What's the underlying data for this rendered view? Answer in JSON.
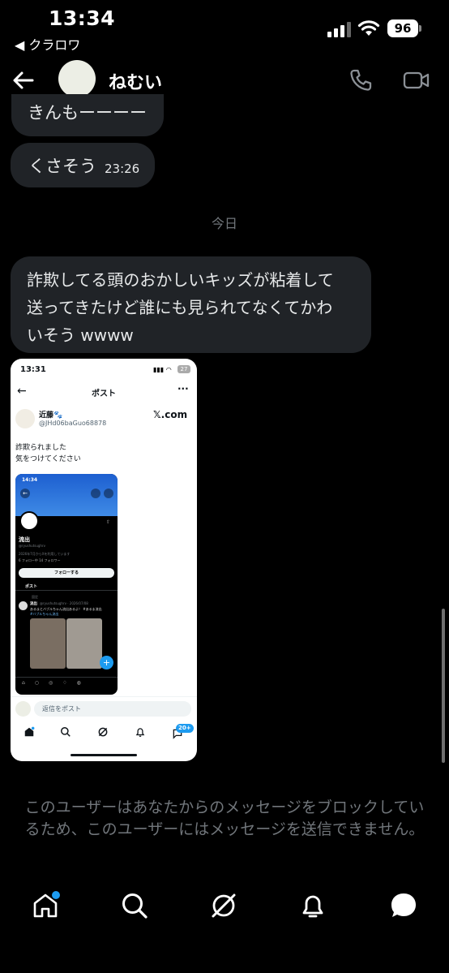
{
  "status": {
    "time": "13:34",
    "back_app": "◀ クラロワ",
    "battery": "96"
  },
  "header": {
    "name": "ねむい"
  },
  "messages": {
    "m1": "きんもーーーー",
    "m2": "くさそう",
    "m2_time": "23:26",
    "date_separator": "今日",
    "m3_lines": [
      "詐欺してる頭のおかしいキッズが粘着して",
      "送ってきたけど誰にも見られてなくてかわ",
      "いそう wwww"
    ]
  },
  "card": {
    "time": "13:31",
    "battery": "27",
    "title": "ポスト",
    "user_name": "近藤🐾",
    "handle": "@JHd06baGuo68878",
    "brand": "𝕏.com",
    "text_line1": "詐欺られました",
    "text_line2": "気をつけてください",
    "inner": {
      "time": "14:34",
      "profile_name": "流出",
      "handle": "@ryushutsughrv",
      "joined": "2026年7月からXを利用しています",
      "follow_counts": "6 フォロー中  14 フォロワー",
      "follow_button": "フォローする",
      "tab_posts": "ポスト",
      "pinned": "固定",
      "post_name": "流出",
      "post_meta": "@ryushutsughrv · 2026/07/08",
      "post_text1": "あるまとバブルちゃん流出あるよ！ #あるま流出",
      "post_text2": "#バブルちゃん流出"
    },
    "reply_placeholder": "返信をポスト",
    "notif_badge": "20+"
  },
  "block_notice": "このユーザーはあなたからのメッセージをブロックしているため、このユーザーにはメッセージを送信できません。",
  "colors": {
    "bubble": "#202327",
    "accent": "#1d9bf0",
    "muted": "#71767b"
  }
}
